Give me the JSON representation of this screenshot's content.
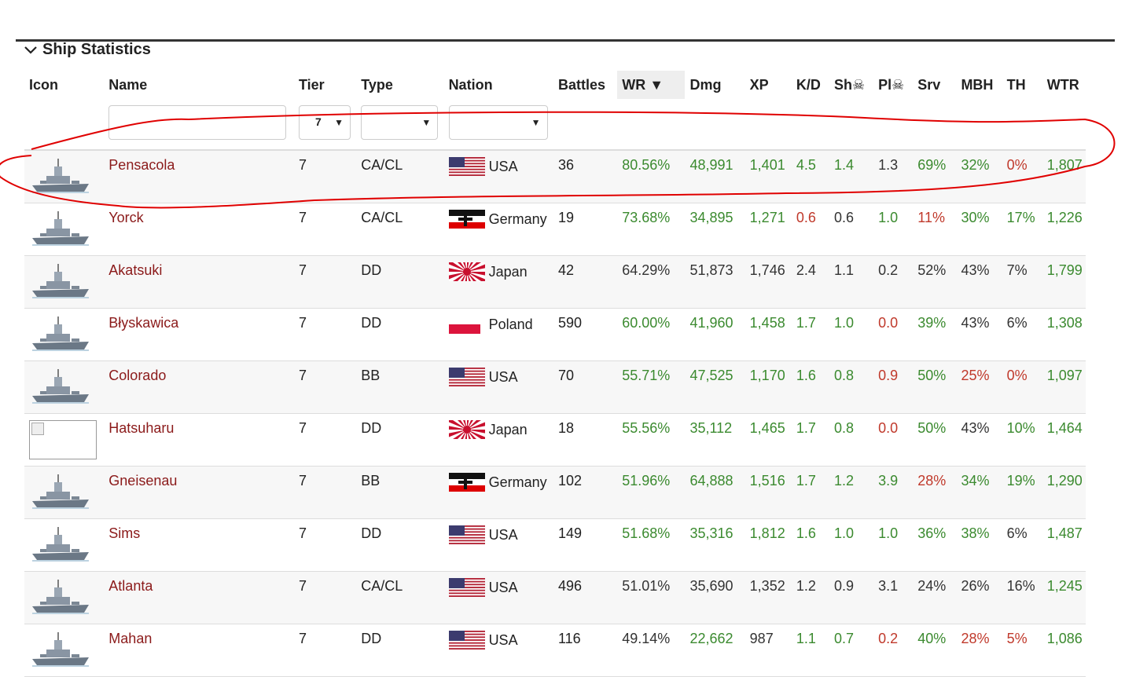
{
  "section": {
    "title": "Ship Statistics"
  },
  "columns": [
    "Icon",
    "Name",
    "Tier",
    "Type",
    "Nation",
    "Battles",
    "WR ▼",
    "Dmg",
    "XP",
    "K/D",
    "Sh☠",
    "Pl☠",
    "Srv",
    "MBH",
    "TH",
    "WTR"
  ],
  "filters": {
    "tier_value": "7"
  },
  "colors": {
    "good": "#3b8a2f",
    "bad": "#c0392b",
    "name": "#8b1a1a",
    "annotation": "#e00000"
  },
  "rows": [
    {
      "name": "Pensacola",
      "tier": "7",
      "type": "CA/CL",
      "nation": "USA",
      "flag": "usa",
      "battles": "36",
      "wr": "80.56%",
      "dmg": "48,991",
      "xp": "1,401",
      "kd": "4.5",
      "sh": "1.4",
      "pl": "1.3",
      "srv": "69%",
      "mbh": "32%",
      "th": "0%",
      "wtr": "1,807",
      "c": {
        "wr": "g",
        "dmg": "g",
        "xp": "g",
        "kd": "g",
        "sh": "g",
        "pl": "k",
        "srv": "g",
        "mbh": "g",
        "th": "r",
        "wtr": "g"
      },
      "icon": "ship"
    },
    {
      "name": "Yorck",
      "tier": "7",
      "type": "CA/CL",
      "nation": "Germany",
      "flag": "germany",
      "battles": "19",
      "wr": "73.68%",
      "dmg": "34,895",
      "xp": "1,271",
      "kd": "0.6",
      "sh": "0.6",
      "pl": "1.0",
      "srv": "11%",
      "mbh": "30%",
      "th": "17%",
      "wtr": "1,226",
      "c": {
        "wr": "g",
        "dmg": "g",
        "xp": "g",
        "kd": "r",
        "sh": "k",
        "pl": "g",
        "srv": "r",
        "mbh": "g",
        "th": "g",
        "wtr": "g"
      },
      "icon": "ship"
    },
    {
      "name": "Akatsuki",
      "tier": "7",
      "type": "DD",
      "nation": "Japan",
      "flag": "japan",
      "battles": "42",
      "wr": "64.29%",
      "dmg": "51,873",
      "xp": "1,746",
      "kd": "2.4",
      "sh": "1.1",
      "pl": "0.2",
      "srv": "52%",
      "mbh": "43%",
      "th": "7%",
      "wtr": "1,799",
      "c": {
        "wr": "k",
        "dmg": "k",
        "xp": "k",
        "kd": "k",
        "sh": "k",
        "pl": "k",
        "srv": "k",
        "mbh": "k",
        "th": "k",
        "wtr": "g"
      },
      "icon": "ship"
    },
    {
      "name": "Błyskawica",
      "tier": "7",
      "type": "DD",
      "nation": "Poland",
      "flag": "poland",
      "battles": "590",
      "wr": "60.00%",
      "dmg": "41,960",
      "xp": "1,458",
      "kd": "1.7",
      "sh": "1.0",
      "pl": "0.0",
      "srv": "39%",
      "mbh": "43%",
      "th": "6%",
      "wtr": "1,308",
      "c": {
        "wr": "g",
        "dmg": "g",
        "xp": "g",
        "kd": "g",
        "sh": "g",
        "pl": "r",
        "srv": "g",
        "mbh": "k",
        "th": "k",
        "wtr": "g"
      },
      "icon": "ship"
    },
    {
      "name": "Colorado",
      "tier": "7",
      "type": "BB",
      "nation": "USA",
      "flag": "usa",
      "battles": "70",
      "wr": "55.71%",
      "dmg": "47,525",
      "xp": "1,170",
      "kd": "1.6",
      "sh": "0.8",
      "pl": "0.9",
      "srv": "50%",
      "mbh": "25%",
      "th": "0%",
      "wtr": "1,097",
      "c": {
        "wr": "g",
        "dmg": "g",
        "xp": "g",
        "kd": "g",
        "sh": "g",
        "pl": "r",
        "srv": "g",
        "mbh": "r",
        "th": "r",
        "wtr": "g"
      },
      "icon": "ship"
    },
    {
      "name": "Hatsuharu",
      "tier": "7",
      "type": "DD",
      "nation": "Japan",
      "flag": "japan",
      "battles": "18",
      "wr": "55.56%",
      "dmg": "35,112",
      "xp": "1,465",
      "kd": "1.7",
      "sh": "0.8",
      "pl": "0.0",
      "srv": "50%",
      "mbh": "43%",
      "th": "10%",
      "wtr": "1,464",
      "c": {
        "wr": "g",
        "dmg": "g",
        "xp": "g",
        "kd": "g",
        "sh": "g",
        "pl": "r",
        "srv": "g",
        "mbh": "k",
        "th": "g",
        "wtr": "g"
      },
      "icon": "broken"
    },
    {
      "name": "Gneisenau",
      "tier": "7",
      "type": "BB",
      "nation": "Germany",
      "flag": "germany",
      "battles": "102",
      "wr": "51.96%",
      "dmg": "64,888",
      "xp": "1,516",
      "kd": "1.7",
      "sh": "1.2",
      "pl": "3.9",
      "srv": "28%",
      "mbh": "34%",
      "th": "19%",
      "wtr": "1,290",
      "c": {
        "wr": "g",
        "dmg": "g",
        "xp": "g",
        "kd": "g",
        "sh": "g",
        "pl": "g",
        "srv": "r",
        "mbh": "g",
        "th": "g",
        "wtr": "g"
      },
      "icon": "ship"
    },
    {
      "name": "Sims",
      "tier": "7",
      "type": "DD",
      "nation": "USA",
      "flag": "usa",
      "battles": "149",
      "wr": "51.68%",
      "dmg": "35,316",
      "xp": "1,812",
      "kd": "1.6",
      "sh": "1.0",
      "pl": "1.0",
      "srv": "36%",
      "mbh": "38%",
      "th": "6%",
      "wtr": "1,487",
      "c": {
        "wr": "g",
        "dmg": "g",
        "xp": "g",
        "kd": "g",
        "sh": "g",
        "pl": "g",
        "srv": "g",
        "mbh": "g",
        "th": "k",
        "wtr": "g"
      },
      "icon": "ship"
    },
    {
      "name": "Atlanta",
      "tier": "7",
      "type": "CA/CL",
      "nation": "USA",
      "flag": "usa",
      "battles": "496",
      "wr": "51.01%",
      "dmg": "35,690",
      "xp": "1,352",
      "kd": "1.2",
      "sh": "0.9",
      "pl": "3.1",
      "srv": "24%",
      "mbh": "26%",
      "th": "16%",
      "wtr": "1,245",
      "c": {
        "wr": "k",
        "dmg": "k",
        "xp": "k",
        "kd": "k",
        "sh": "k",
        "pl": "k",
        "srv": "k",
        "mbh": "k",
        "th": "k",
        "wtr": "g"
      },
      "icon": "ship"
    },
    {
      "name": "Mahan",
      "tier": "7",
      "type": "DD",
      "nation": "USA",
      "flag": "usa",
      "battles": "116",
      "wr": "49.14%",
      "dmg": "22,662",
      "xp": "987",
      "kd": "1.1",
      "sh": "0.7",
      "pl": "0.2",
      "srv": "40%",
      "mbh": "28%",
      "th": "5%",
      "wtr": "1,086",
      "c": {
        "wr": "k",
        "dmg": "g",
        "xp": "k",
        "kd": "g",
        "sh": "g",
        "pl": "r",
        "srv": "g",
        "mbh": "r",
        "th": "r",
        "wtr": "g"
      },
      "icon": "ship"
    }
  ]
}
